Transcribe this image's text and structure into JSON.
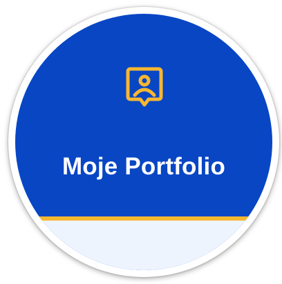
{
  "tile": {
    "title": "Moje Portfolio",
    "icon": "portfolio-icon",
    "colors": {
      "background": "#0846c4",
      "accent": "#f7b731",
      "footer": "#eef4fe",
      "text": "#ffffff"
    }
  }
}
